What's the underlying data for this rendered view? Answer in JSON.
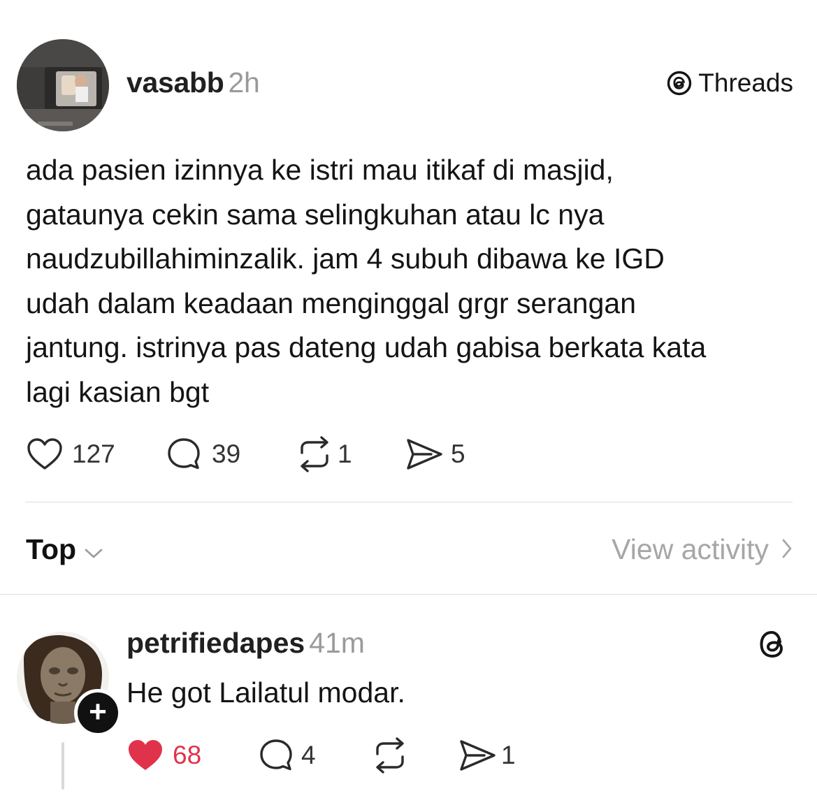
{
  "post": {
    "username": "vasabb",
    "time": "2h",
    "brand_icon": "threads-logo-icon",
    "brand": "Threads",
    "lines": [
      "ada pasien izinnya ke istri mau itikaf di masjid,",
      "gataunya cekin sama selingkuhan atau lc nya",
      "naudzubillahiminzalik. jam 4 subuh dibawa ke IGD",
      "udah dalam keadaan menginggal grgr serangan",
      "jantung. istrinya pas dateng udah gabisa berkata kata",
      "lagi kasian bgt"
    ],
    "stats": {
      "likes": "127",
      "replies": "39",
      "reposts": "1",
      "shares": "5"
    }
  },
  "sort": {
    "label": "Top",
    "view_activity": "View activity"
  },
  "reply": {
    "username": "petrifiedapes",
    "time": "41m",
    "text": "He got Lailatul modar.",
    "follow_badge": "+",
    "liked": true,
    "stats": {
      "likes": "68",
      "replies": "4",
      "reposts": "",
      "shares": "1"
    }
  },
  "colors": {
    "liked": "#e0334b",
    "muted": "#9a9a9a",
    "text": "#141414"
  }
}
